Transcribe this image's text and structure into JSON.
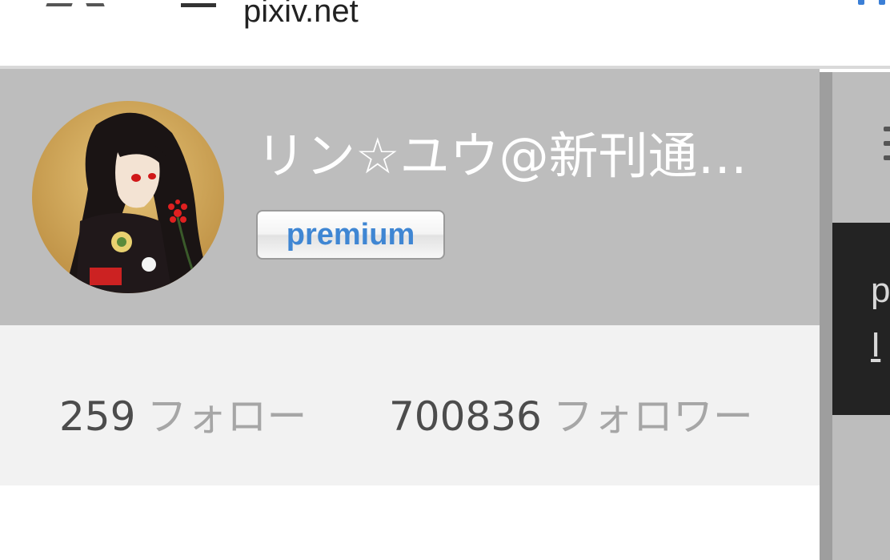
{
  "browser": {
    "url": "pixiv.net"
  },
  "profile": {
    "username": "リン☆ユウ@新刊通…",
    "badge": "premium",
    "stats": {
      "following_count": "259",
      "following_label": "フォロー",
      "followers_count": "700836",
      "followers_label": "フォロワー"
    }
  },
  "side_panel": {
    "tooltip_text": "p",
    "tooltip_link": "I"
  },
  "colors": {
    "header_bg": "#bdbdbd",
    "stats_bg": "#f2f2f2",
    "badge_text": "#3f86d3"
  }
}
